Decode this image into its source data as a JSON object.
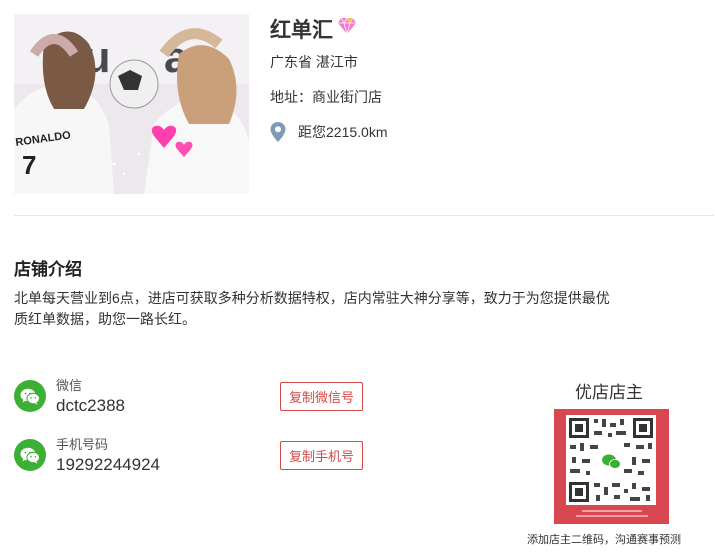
{
  "shop": {
    "name": "红单汇",
    "region": "广东省 湛江市",
    "address_label": "地址：",
    "address_value": "商业街门店",
    "distance": "距您2215.0km"
  },
  "photo": {
    "jersey_text": "RONALDO"
  },
  "intro": {
    "title": "店铺介绍",
    "text": "北单每天营业到6点，进店可获取多种分析数据特权，店内常驻大神分享等，致力于为您提供最优质红单数据，助您一路长红。"
  },
  "contacts": [
    {
      "key": "微信",
      "value": "dctc2388",
      "button": "复制微信号"
    },
    {
      "key": "手机号码",
      "value": "19292244924",
      "button": "复制手机号"
    }
  ],
  "owner": {
    "title": "优店店主",
    "caption": "添加店主二维码，沟通赛事预测"
  },
  "colors": {
    "accent_red": "#d24848",
    "wechat_green": "#3cb034",
    "qr_background": "#d8464f",
    "pin": "#7d9bb5"
  },
  "icons": [
    "diamond-icon",
    "location-pin-icon",
    "wechat-icon"
  ]
}
